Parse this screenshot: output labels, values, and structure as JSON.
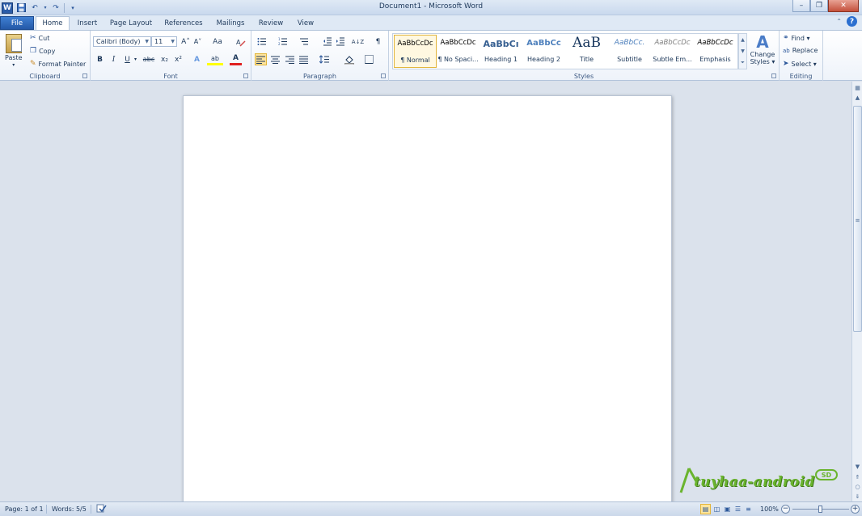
{
  "window": {
    "title": "Document1 - Microsoft Word",
    "app_icon": "W",
    "minimize": "–",
    "maximize": "❐",
    "close": "✕"
  },
  "tabs": {
    "file": "File",
    "home": "Home",
    "insert": "Insert",
    "page_layout": "Page Layout",
    "references": "References",
    "mailings": "Mailings",
    "review": "Review",
    "view": "View",
    "help": "?",
    "collapse": "⌃"
  },
  "clipboard": {
    "label": "Clipboard",
    "paste": "Paste",
    "cut": "Cut",
    "copy": "Copy",
    "format_painter": "Format Painter"
  },
  "font": {
    "label": "Font",
    "font_name": "Calibri (Body)",
    "font_size": "11",
    "grow": "A˄",
    "shrink": "A˅",
    "change_case": "Aa",
    "bold": "B",
    "italic": "I",
    "underline": "U",
    "strikethrough": "abc",
    "subscript": "x₂",
    "superscript": "x²",
    "text_effects": "A",
    "highlight": "ab",
    "font_color": "A"
  },
  "paragraph": {
    "label": "Paragraph",
    "pilcrow": "¶",
    "sort": "A↓Z"
  },
  "styles": {
    "label": "Styles",
    "items": [
      {
        "sample": "AaBbCcDc",
        "name": "¶ Normal"
      },
      {
        "sample": "AaBbCcDc",
        "name": "¶ No Spaci..."
      },
      {
        "sample": "AaBbCı",
        "name": "Heading 1"
      },
      {
        "sample": "AaBbCc",
        "name": "Heading 2"
      },
      {
        "sample": "AaB",
        "name": "Title"
      },
      {
        "sample": "AaBbCc.",
        "name": "Subtitle"
      },
      {
        "sample": "AaBbCcDc",
        "name": "Subtle Em..."
      },
      {
        "sample": "AaBbCcDc",
        "name": "Emphasis"
      }
    ],
    "change_styles_line1": "Change",
    "change_styles_line2": "Styles ▾"
  },
  "editing": {
    "label": "Editing",
    "find": "Find ▾",
    "replace": "Replace",
    "select": "Select ▾"
  },
  "statusbar": {
    "page": "Page: 1 of 1",
    "words": "Words: 5/5",
    "zoom": "100%"
  },
  "watermark": {
    "text": "tuyhaa-android",
    "badge": "SD"
  },
  "colors": {
    "accent": "#2b579a",
    "file_tab": "#2459a8",
    "selection": "#fde49c",
    "workspace": "#dbe2ec"
  }
}
